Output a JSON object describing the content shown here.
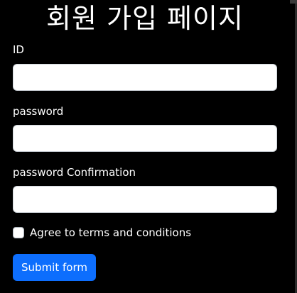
{
  "page": {
    "title": "회원 가입 페이지"
  },
  "form": {
    "id": {
      "label": "ID",
      "value": "",
      "placeholder": ""
    },
    "password": {
      "label": "password",
      "value": "",
      "placeholder": ""
    },
    "password_confirmation": {
      "label": "password Confirmation",
      "value": "",
      "placeholder": ""
    },
    "terms": {
      "label": "Agree to terms and conditions",
      "checked": false
    },
    "submit_label": "Submit form"
  },
  "colors": {
    "background": "#000000",
    "text": "#ffffff",
    "input_background": "#ffffff",
    "input_border": "#ced4da",
    "button_primary": "#0d6efd"
  }
}
